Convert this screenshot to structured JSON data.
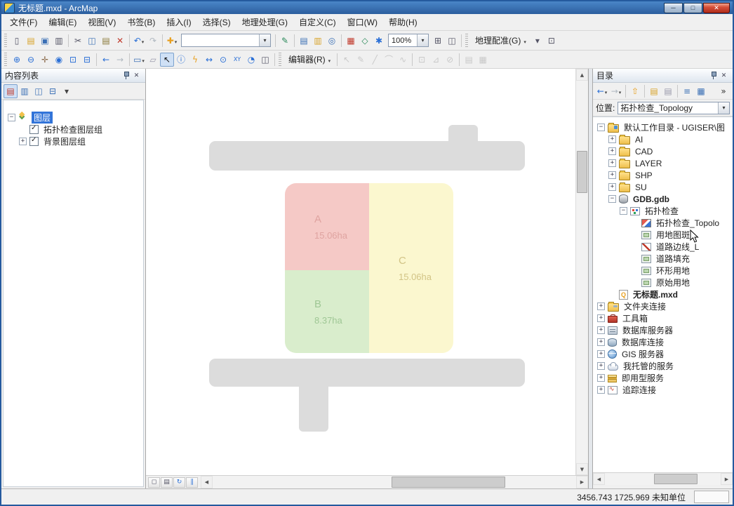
{
  "window": {
    "title": "无标题.mxd - ArcMap",
    "min": "─",
    "max": "□",
    "close": "✕"
  },
  "menubar": [
    {
      "name": "menu-file",
      "label": "文件(F)"
    },
    {
      "name": "menu-edit",
      "label": "编辑(E)"
    },
    {
      "name": "menu-view",
      "label": "视图(V)"
    },
    {
      "name": "menu-bookmarks",
      "label": "书签(B)"
    },
    {
      "name": "menu-insert",
      "label": "插入(I)"
    },
    {
      "name": "menu-selection",
      "label": "选择(S)"
    },
    {
      "name": "menu-geoprocessing",
      "label": "地理处理(G)"
    },
    {
      "name": "menu-customize",
      "label": "自定义(C)"
    },
    {
      "name": "menu-windows",
      "label": "窗口(W)"
    },
    {
      "name": "menu-help",
      "label": "帮助(H)"
    }
  ],
  "toolbar1": [
    {
      "t": "grip"
    },
    {
      "t": "icon",
      "name": "new-document-icon",
      "g": "▯",
      "c": "#556"
    },
    {
      "t": "icon",
      "name": "open-folder-icon",
      "g": "▤",
      "c": "#d8a32a"
    },
    {
      "t": "icon",
      "name": "save-icon",
      "g": "▣",
      "c": "#3a6fb5"
    },
    {
      "t": "icon",
      "name": "print-icon",
      "g": "▥",
      "c": "#556"
    },
    {
      "t": "sep"
    },
    {
      "t": "icon",
      "name": "cut-icon",
      "g": "✂",
      "c": "#556"
    },
    {
      "t": "icon",
      "name": "copy-icon",
      "g": "◫",
      "c": "#3a6fb5"
    },
    {
      "t": "icon",
      "name": "paste-icon",
      "g": "▤",
      "c": "#8a7a3a"
    },
    {
      "t": "icon",
      "name": "delete-icon",
      "g": "✕",
      "c": "#c0392b"
    },
    {
      "t": "sep"
    },
    {
      "t": "icon",
      "name": "undo-icon",
      "g": "↶",
      "c": "#2a6fd6",
      "dd": true
    },
    {
      "t": "icon",
      "name": "redo-icon",
      "g": "↷",
      "c": "#b0b8c0"
    },
    {
      "t": "sep"
    },
    {
      "t": "icon",
      "name": "add-data-icon",
      "g": "✚",
      "c": "#e8a020",
      "dd": true
    },
    {
      "t": "combo",
      "name": "map-scale-combo",
      "value": "",
      "w": 128
    },
    {
      "t": "sep"
    },
    {
      "t": "icon",
      "name": "editor-toolbar-icon",
      "g": "✎",
      "c": "#2a8a5a"
    },
    {
      "t": "sep"
    },
    {
      "t": "icon",
      "name": "table-of-contents-window-icon",
      "g": "▤",
      "c": "#3a6fb5"
    },
    {
      "t": "icon",
      "name": "catalog-window-icon",
      "g": "▥",
      "c": "#d8a32a"
    },
    {
      "t": "icon",
      "name": "search-window-icon",
      "g": "◎",
      "c": "#3a6fb5"
    },
    {
      "t": "sep"
    },
    {
      "t": "icon",
      "name": "arctoolbox-icon",
      "g": "▦",
      "c": "#c0392b"
    },
    {
      "t": "icon",
      "name": "python-window-icon",
      "g": "◇",
      "c": "#2a8a5a"
    },
    {
      "t": "icon",
      "name": "model-builder-icon",
      "g": "✱",
      "c": "#2a6fd6"
    },
    {
      "t": "combo",
      "name": "zoom-percent-combo",
      "value": "100%",
      "w": 58
    },
    {
      "t": "icon",
      "name": "pixel-swipe-icon",
      "g": "⊞",
      "c": "#556"
    },
    {
      "t": "icon",
      "name": "viewer-window-icon",
      "g": "◫",
      "c": "#556"
    },
    {
      "t": "sep"
    },
    {
      "t": "grip"
    },
    {
      "t": "menu",
      "name": "georeferencing-menu",
      "label": "地理配准(G)"
    },
    {
      "t": "icon",
      "name": "georeferencing-layer-icon",
      "g": "▾",
      "c": "#556"
    },
    {
      "t": "icon",
      "name": "georeferencing-tools-icon",
      "g": "⊡",
      "c": "#556"
    }
  ],
  "toolbar2": [
    {
      "t": "grip"
    },
    {
      "t": "icon",
      "name": "zoom-in-icon",
      "g": "⊕",
      "c": "#2a6fd6"
    },
    {
      "t": "icon",
      "name": "zoom-out-icon",
      "g": "⊖",
      "c": "#2a6fd6"
    },
    {
      "t": "icon",
      "name": "pan-icon",
      "g": "✛",
      "c": "#8a6a4a"
    },
    {
      "t": "icon",
      "name": "full-extent-icon",
      "g": "◉",
      "c": "#2a6fd6"
    },
    {
      "t": "icon",
      "name": "fixed-zoom-in-icon",
      "g": "⊡",
      "c": "#2a6fd6"
    },
    {
      "t": "icon",
      "name": "fixed-zoom-out-icon",
      "g": "⊟",
      "c": "#2a6fd6"
    },
    {
      "t": "sep"
    },
    {
      "t": "icon",
      "name": "go-back-extent-icon",
      "g": "←",
      "c": "#2a6fd6"
    },
    {
      "t": "icon",
      "name": "go-forward-extent-icon",
      "g": "→",
      "c": "#b0b8c0"
    },
    {
      "t": "sep"
    },
    {
      "t": "icon",
      "name": "select-features-icon",
      "g": "▭",
      "c": "#3a6fb5",
      "dd": true
    },
    {
      "t": "icon",
      "name": "clear-selection-icon",
      "g": "▱",
      "c": "#99a"
    },
    {
      "t": "icon",
      "name": "select-elements-icon",
      "g": "↖",
      "c": "#111",
      "pressed": true
    },
    {
      "t": "icon",
      "name": "identify-icon",
      "g": "ⓘ",
      "c": "#2a6fd6"
    },
    {
      "t": "icon",
      "name": "hyperlink-icon",
      "g": "ϟ",
      "c": "#e8a020"
    },
    {
      "t": "icon",
      "name": "measure-icon",
      "g": "↔",
      "c": "#2a6fd6"
    },
    {
      "t": "icon",
      "name": "find-icon",
      "g": "⊙",
      "c": "#2a6fd6"
    },
    {
      "t": "icon",
      "name": "go-to-xy-icon",
      "g": "XY",
      "c": "#2a6fd6",
      "fs": 8
    },
    {
      "t": "icon",
      "name": "time-slider-icon",
      "g": "◔",
      "c": "#2a6fd6"
    },
    {
      "t": "icon",
      "name": "html-popup-icon",
      "g": "◫",
      "c": "#556"
    },
    {
      "t": "sep"
    },
    {
      "t": "grip"
    },
    {
      "t": "menu",
      "name": "editor-menu",
      "label": "编辑器(R)"
    },
    {
      "t": "sep"
    },
    {
      "t": "icon",
      "name": "edit-tool-icon",
      "g": "↖",
      "c": "#999",
      "dis": true
    },
    {
      "t": "icon",
      "name": "edit-annotation-icon",
      "g": "✎",
      "c": "#999",
      "dis": true
    },
    {
      "t": "icon",
      "name": "straight-segment-icon",
      "g": "╱",
      "c": "#999",
      "dis": true
    },
    {
      "t": "icon",
      "name": "endpoint-arc-icon",
      "g": "⌒",
      "c": "#999",
      "dis": true
    },
    {
      "t": "icon",
      "name": "trace-tool-icon",
      "g": "∿",
      "c": "#999",
      "dis": true
    },
    {
      "t": "sep"
    },
    {
      "t": "icon",
      "name": "edit-vertices-icon",
      "g": "⊡",
      "c": "#999",
      "dis": true
    },
    {
      "t": "icon",
      "name": "reshape-feature-icon",
      "g": "⊿",
      "c": "#999",
      "dis": true
    },
    {
      "t": "icon",
      "name": "cut-polygons-icon",
      "g": "⊘",
      "c": "#999",
      "dis": true
    },
    {
      "t": "sep"
    },
    {
      "t": "icon",
      "name": "attributes-icon",
      "g": "▤",
      "c": "#999",
      "dis": true
    },
    {
      "t": "icon",
      "name": "sketch-properties-icon",
      "g": "▦",
      "c": "#999",
      "dis": true
    }
  ],
  "toc": {
    "header": "内容列表",
    "header_buttons": [
      {
        "name": "pin-icon",
        "g": "pin"
      },
      {
        "name": "close-panel-icon",
        "g": "✕"
      }
    ],
    "toolbar": [
      {
        "t": "icon",
        "name": "list-by-drawing-order-icon",
        "g": "▤",
        "c": "#c0392b",
        "pressed": true
      },
      {
        "t": "icon",
        "name": "list-by-source-icon",
        "g": "▥",
        "c": "#3a6fb5"
      },
      {
        "t": "icon",
        "name": "list-by-visibility-icon",
        "g": "◫",
        "c": "#3a6fb5"
      },
      {
        "t": "icon",
        "name": "list-by-selection-icon",
        "g": "⊟",
        "c": "#3a6fb5"
      },
      {
        "t": "icon",
        "name": "toc-options-icon",
        "g": "▾",
        "c": "#444"
      }
    ],
    "tree": [
      {
        "level": 0,
        "exp": "−",
        "icon": "layers-icon",
        "label": "图层",
        "selected": true
      },
      {
        "level": 1,
        "check": true,
        "label": "拓扑检查图层组"
      },
      {
        "level": 1,
        "exp": "+",
        "check": true,
        "label": "背景图层组"
      }
    ]
  },
  "map": {
    "parcels": [
      {
        "letter": "A",
        "area": "15.06ha",
        "fill": "#f5c9c6"
      },
      {
        "letter": "B",
        "area": "8.37ha",
        "fill": "#d9edcc"
      },
      {
        "letter": "C",
        "area": "15.06ha",
        "fill": "#fbf7cf"
      }
    ],
    "road_color": "#dcdcdc",
    "view_buttons": [
      {
        "name": "data-view-button",
        "g": "◻",
        "c": "#556"
      },
      {
        "name": "layout-view-button",
        "g": "▤",
        "c": "#556"
      },
      {
        "name": "refresh-view-button",
        "g": "↻",
        "c": "#2a6fd6"
      },
      {
        "name": "pause-drawing-button",
        "g": "∥",
        "c": "#2a6fd6"
      }
    ]
  },
  "catalog": {
    "header": "目录",
    "header_buttons": [
      {
        "name": "pin-icon",
        "g": "pin"
      },
      {
        "name": "close-panel-icon",
        "g": "✕"
      }
    ],
    "toolbar": [
      {
        "t": "icon",
        "name": "back-arrow-icon",
        "g": "←",
        "c": "#2a6fd6",
        "dd": true
      },
      {
        "t": "icon",
        "name": "forward-arrow-icon",
        "g": "→",
        "c": "#b0b8c0",
        "dd": true
      },
      {
        "t": "sep"
      },
      {
        "t": "icon",
        "name": "up-one-level-icon",
        "g": "⇧",
        "c": "#e8a020"
      },
      {
        "t": "sep"
      },
      {
        "t": "icon",
        "name": "connect-folder-icon",
        "g": "▤",
        "c": "#d8a32a"
      },
      {
        "t": "icon",
        "name": "disconnect-folder-icon",
        "g": "▤",
        "c": "#99a"
      },
      {
        "t": "sep"
      },
      {
        "t": "icon",
        "name": "contents-view-icon",
        "g": "≡",
        "c": "#3a6fb5"
      },
      {
        "t": "icon",
        "name": "thumbnails-view-icon",
        "g": "▦",
        "c": "#3a6fb5"
      },
      {
        "t": "icon",
        "name": "toolbar-overflow-icon",
        "g": "»",
        "c": "#333",
        "push": true
      }
    ],
    "location_label": "位置:",
    "location_value": "拓扑检查_Topology",
    "tree": [
      {
        "level": 0,
        "exp": "−",
        "icon": "home-folder-icon",
        "label": "默认工作目录 - UGISER\\图"
      },
      {
        "level": 1,
        "exp": "+",
        "icon": "folder-icon",
        "label": "AI"
      },
      {
        "level": 1,
        "exp": "+",
        "icon": "folder-icon",
        "label": "CAD"
      },
      {
        "level": 1,
        "exp": "+",
        "icon": "folder-icon",
        "label": "LAYER"
      },
      {
        "level": 1,
        "exp": "+",
        "icon": "folder-icon",
        "label": "SHP"
      },
      {
        "level": 1,
        "exp": "+",
        "icon": "folder-icon",
        "label": "SU"
      },
      {
        "level": 1,
        "exp": "−",
        "icon": "gdb-icon",
        "label": "GDB.gdb",
        "bold": true
      },
      {
        "level": 2,
        "exp": "−",
        "icon": "dataset-icon",
        "label": "拓扑检查"
      },
      {
        "level": 3,
        "icon": "topology-icon",
        "label": "拓扑检查_Topolo"
      },
      {
        "level": 3,
        "icon": "polygon-icon",
        "label": "用地图斑"
      },
      {
        "level": 3,
        "icon": "line-icon",
        "label": "道路边线_L"
      },
      {
        "level": 3,
        "icon": "polygon-icon",
        "label": "道路填充"
      },
      {
        "level": 3,
        "icon": "polygon-icon",
        "label": "环形用地"
      },
      {
        "level": 3,
        "icon": "polygon-icon",
        "label": "原始用地"
      },
      {
        "level": 1,
        "icon": "mxd-icon",
        "label": "无标题.mxd",
        "bold": true
      },
      {
        "level": 0,
        "exp": "+",
        "icon": "folder-connections-icon",
        "label": "文件夹连接"
      },
      {
        "level": 0,
        "exp": "+",
        "icon": "toolbox-icon",
        "label": "工具箱"
      },
      {
        "level": 0,
        "exp": "+",
        "icon": "db-servers-icon",
        "label": "数据库服务器"
      },
      {
        "level": 0,
        "exp": "+",
        "icon": "db-connections-icon",
        "label": "数据库连接"
      },
      {
        "level": 0,
        "exp": "+",
        "icon": "gis-servers-icon",
        "label": "GIS 服务器"
      },
      {
        "level": 0,
        "exp": "+",
        "icon": "hosted-services-icon",
        "label": "我托管的服务"
      },
      {
        "level": 0,
        "exp": "+",
        "icon": "ready-services-icon",
        "label": "即用型服务"
      },
      {
        "level": 0,
        "exp": "+",
        "icon": "tracing-connections-icon",
        "label": "追踪连接"
      }
    ]
  },
  "statusbar": {
    "coords": "3456.743  1725.969  未知单位"
  }
}
